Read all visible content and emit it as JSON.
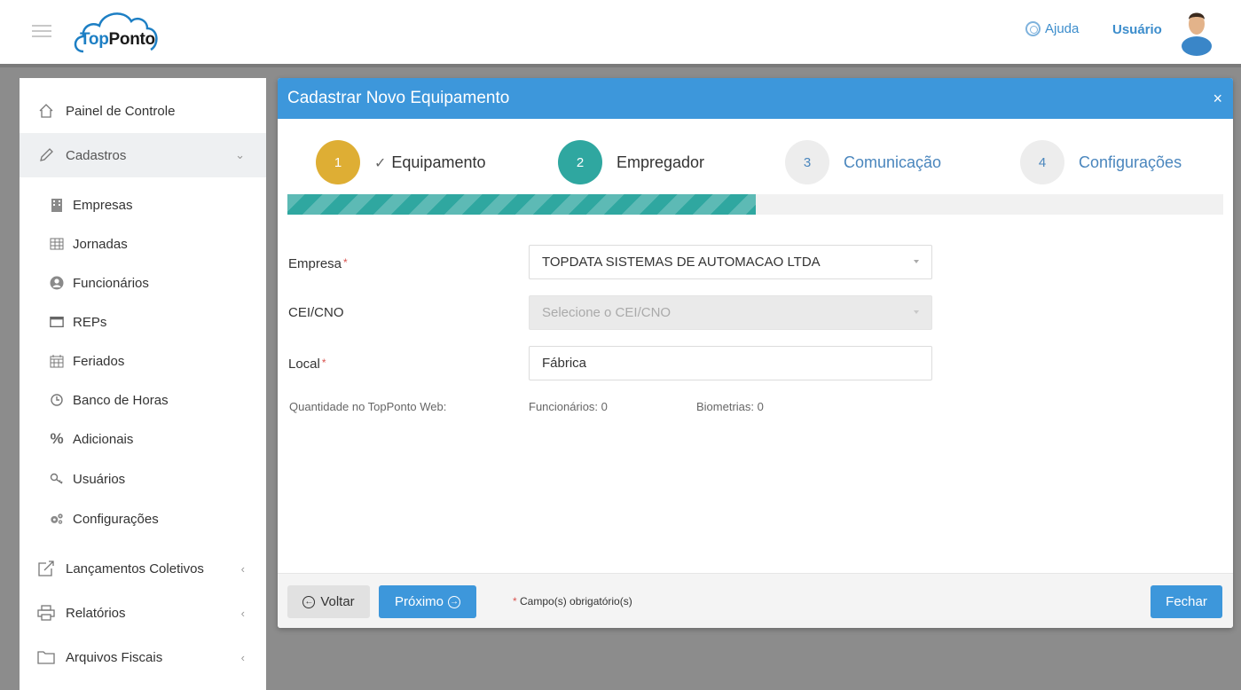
{
  "header": {
    "logo_part1": "Top",
    "logo_part2": "Ponto",
    "help_label": "Ajuda",
    "user_label": "Usuário"
  },
  "sidebar": {
    "items": [
      {
        "label": "Painel de Controle",
        "icon": "home-icon"
      },
      {
        "label": "Cadastros",
        "icon": "pencil-icon",
        "expanded": true
      },
      {
        "label": "Lançamentos Coletivos",
        "icon": "edit-external-icon"
      },
      {
        "label": "Relatórios",
        "icon": "printer-icon"
      },
      {
        "label": "Arquivos Fiscais",
        "icon": "folder-icon"
      }
    ],
    "sub_items": [
      {
        "label": "Empresas",
        "icon": "building-icon"
      },
      {
        "label": "Jornadas",
        "icon": "table-icon"
      },
      {
        "label": "Funcionários",
        "icon": "user-circle-icon"
      },
      {
        "label": "REPs",
        "icon": "window-icon"
      },
      {
        "label": "Feriados",
        "icon": "calendar-icon"
      },
      {
        "label": "Banco de Horas",
        "icon": "clock-icon"
      },
      {
        "label": "Adicionais",
        "icon": "percent-icon"
      },
      {
        "label": "Usuários",
        "icon": "key-icon"
      },
      {
        "label": "Configurações",
        "icon": "gears-icon"
      }
    ]
  },
  "modal": {
    "title": "Cadastrar Novo Equipamento",
    "close_label": "×",
    "steps": [
      {
        "number": "1",
        "label": "Equipamento",
        "state": "done"
      },
      {
        "number": "2",
        "label": "Empregador",
        "state": "current"
      },
      {
        "number": "3",
        "label": "Comunicação",
        "state": "todo"
      },
      {
        "number": "4",
        "label": "Configurações",
        "state": "todo"
      }
    ],
    "progress_fraction": 0.5,
    "form": {
      "empresa_label": "Empresa",
      "empresa_value": "TOPDATA SISTEMAS DE AUTOMACAO LTDA",
      "cei_label": "CEI/CNO",
      "cei_placeholder": "Selecione o CEI/CNO",
      "local_label": "Local",
      "local_value": "Fábrica",
      "required_mark": "*"
    },
    "quantity": {
      "label": "Quantidade no TopPonto Web:",
      "funcionarios": "Funcionários: 0",
      "biometrias": "Biometrias: 0"
    },
    "footer": {
      "back_label": "Voltar",
      "next_label": "Próximo",
      "required_note": "Campo(s) obrigatório(s)",
      "close_label": "Fechar"
    }
  },
  "colors": {
    "primary": "#3d97db",
    "step_done": "#deae34",
    "step_current": "#2fa7a0",
    "required": "#d9534f"
  }
}
